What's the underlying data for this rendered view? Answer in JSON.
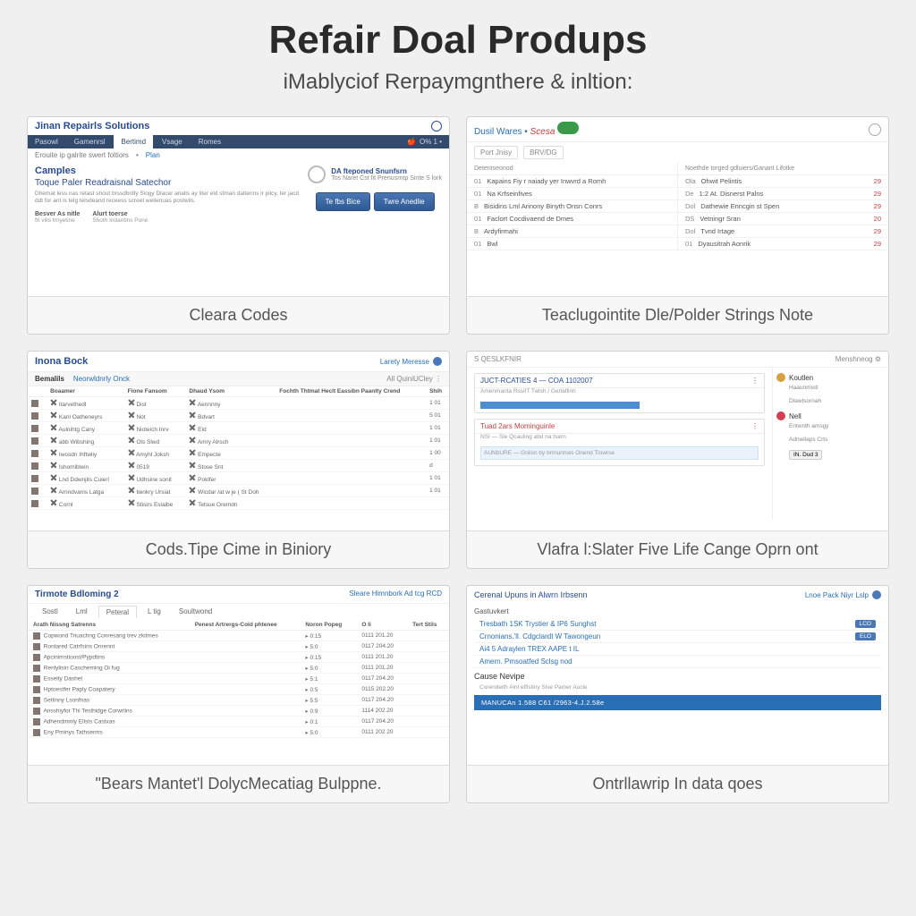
{
  "page": {
    "title": "Refair Doal Produps",
    "subtitle": "iMablyciof Rerpaymgnthere & inltion:"
  },
  "cards": [
    {
      "caption": "Cleara Codes",
      "brand": "Jinan Repairls Solutions",
      "nav": [
        "Pasowl",
        "Gamenrsl",
        "Bertimd",
        "Vsage",
        "Romes"
      ],
      "nav_right": "O% 1 •",
      "subline_a": "Erouite ip galrite swert foltiors",
      "subline_link": "Plan",
      "heading": "Camples",
      "subheading": "Toque Paler Readraisnal Satechor",
      "para": "Dhemat less nas retast shout brssdbritly Slogy Dlacer analis ay liter eld stman datienns ir pilcy, ter jacd ddt for ant is telg telsdeand receess screet welienuas postwils.",
      "col1_h": "Besver As nitle",
      "col1_p": "frl vilis trnyetine",
      "col2_h": "Alurt toerse",
      "col2_p": "Shoth Indantins Pune",
      "badge_a": "DA fteponed Snunfsrn",
      "badge_b": "Tos Naret Cst fit Prenusrntp Sinte S lork",
      "btn1": "Te fbs Bice",
      "btn2": "Twre Anedlie"
    },
    {
      "caption": "Teaclugointite Dle/Polder Strings Note",
      "brand_a": "Dusil Wares •",
      "brand_b": "Scesa",
      "tab1": "Port Jnisy",
      "tab2": "BRV/DG",
      "col1_header": "Detentseonod",
      "col2_header": "Noethde torged gdluiers/Ganant Lifotke",
      "left_rows": [
        {
          "b": "01",
          "l": "Kapains Fiy r naiady yer Inwvrd a Romh"
        },
        {
          "b": "01",
          "l": "Na Krfseinfives"
        },
        {
          "b": "B",
          "l": "Bisidins Lml Arinony Binyth Onsn Conrs"
        },
        {
          "b": "01",
          "l": "Faclort Cocdivaend de Dmes"
        },
        {
          "b": "B",
          "l": "Ardyfirmahi"
        },
        {
          "b": "01",
          "l": "Bwl"
        }
      ],
      "right_rows": [
        {
          "b": "Ola",
          "l": "Ohwit Pelintis",
          "n": "29"
        },
        {
          "b": "De",
          "l": "1:2 At. Disnerst Palns",
          "n": "29"
        },
        {
          "b": "Dol",
          "l": "Dathewie Enncgin st Spen",
          "n": "29"
        },
        {
          "b": "DS",
          "l": "Vetningr Sran",
          "n": "20"
        },
        {
          "b": "Dol",
          "l": "Tvnd Irtage",
          "n": "29"
        },
        {
          "b": "01",
          "l": "Dyausitrah Aonrik",
          "n": "29"
        }
      ]
    },
    {
      "caption": "Cods.Tipe Cime in Biniory",
      "brand": "Inona Bock",
      "link_text": "Larety Meresse",
      "bar_a": "Bemalils",
      "bar_b": "Neorwldnrly Onck",
      "bar_right": "All QuiniUCley  ⋮",
      "cols": [
        "",
        "Boaamer",
        "Fione Fansom",
        "Dhaud Ysom",
        "Fochth Thtmat Heclt Eassibn Paanlty Crend",
        "Shih"
      ],
      "rows": [
        [
          "",
          "Itarvethedl",
          "Dist",
          "Aennnny",
          "",
          "1  01"
        ],
        [
          "",
          "Kanl Oatheneyrs",
          "Not",
          "Bdvart",
          "",
          "5  01"
        ],
        [
          "",
          "Aulnihtg Cany",
          "Nioteich Inrv",
          "Eld",
          "",
          "1  01"
        ],
        [
          "",
          "abb Wibshing",
          "Ols Slwd",
          "Amry Alrsch",
          "",
          "1  01"
        ],
        [
          "",
          "Iwosdn Ihftwliy",
          "Amyhl Joksh",
          "Empecte",
          "",
          "1  00"
        ],
        [
          "",
          "Ishomibtein",
          "0519",
          "Stose Snt",
          "",
          "d"
        ],
        [
          "",
          "Lnd Ddwnjits Cuierl",
          "Udhsine sonit",
          "Poklfer",
          "",
          "1  01"
        ],
        [
          "",
          "Arnndvanis Latga",
          "tienkry Ursiat",
          "Wicdar /at w je ( St Doh",
          "",
          "1  01"
        ],
        [
          "",
          "Cornl",
          "Stisirs Eslaibe",
          "Tetsue Oremdn",
          "",
          ""
        ]
      ]
    },
    {
      "caption": "Vlafra l:Slater Five Life Cange Oprn ont",
      "top_left": "S QESLKFNIR",
      "top_right": "Menshneog ⚙",
      "panel1_h": "JUCT-RCATIES 4 — COA 1102007",
      "panel1_sub": "Amenmanta RssIlT Twlsh / Gerlaflinh",
      "panel2_h": "Tuad 2ars Mominguinle",
      "panel2_sub": "NSI — Sle Qcauling abd na tsern",
      "panel2_btn": "AUNbURE — Gniisn by brrnunnws  Onend Tiowrse",
      "side1_h": "Koutlen",
      "side1_items": [
        "Haaunmistl",
        "Dlawtsornah"
      ],
      "side2_h": "Nell",
      "side2_items": [
        "Entwnth amsgy",
        "Adnwilaps Crts",
        "IN. Dud  3"
      ]
    },
    {
      "caption": "\"Bears Mantet'l DolycMecatiag Bulppne.",
      "brand": "Tirmote Bdloming 2",
      "right_text": "Sleare Himnbork Ad tcg RCD",
      "tabs": [
        "Sostl",
        "Lml",
        "Peteral",
        "L tig",
        "Soultwond"
      ],
      "cols": [
        "Arath Nissng Satrenns",
        "Penest Artrergs-Cold phtenee",
        "Noron Popeg",
        "O li",
        "Tert Stils"
      ],
      "rows": [
        [
          "Copwond Triuachng Conresang trev zkitmes",
          "",
          "0:15",
          "0111 201.20",
          ""
        ],
        [
          "Rontared Catrfsins Onrennt",
          "",
          "5:0",
          "0117 204.20",
          ""
        ],
        [
          "Apcinimstioost/Pypdtins",
          "",
          "0:15",
          "0111 201.20",
          ""
        ],
        [
          "Renlylisin Cascheming Oi fug",
          "",
          "5:0",
          "0111 201.20",
          ""
        ],
        [
          "Esselty Dashet",
          "",
          "5:1",
          "0117 204.20",
          ""
        ],
        [
          "Hptoestfer Paply Coapatery",
          "",
          "0:5",
          "0115 202.20",
          ""
        ],
        [
          "Setlinny Lsonfnas",
          "",
          "5:5",
          "0117 204.20",
          ""
        ],
        [
          "Ansshiyfor Thi Testhidge Corwrlins",
          "",
          "0:9",
          "1114 202.20",
          ""
        ],
        [
          "Adhendminly Ellsts Castxas",
          "",
          "0:1",
          "0117 204.20",
          ""
        ],
        [
          "Eny Pminys Tathserms",
          "",
          "5:0",
          "0111 202 20",
          ""
        ]
      ]
    },
    {
      "caption": "Ontrllawrip In data qoes",
      "top": "Cerenal Upuns in Alwrn Irbsenn",
      "link": "Lnoe Pack Niyr Lslp",
      "sec1_h": "Gastuvkert",
      "items1": [
        {
          "t": "Tresbath 1SK Trystier & IP6 Sunghst",
          "badge": "LCO"
        },
        {
          "t": "Crnonians.'ll. Cdgclardt W Tawongeun",
          "badge": "ELO"
        },
        {
          "t": "Ai4 5 Adraylen TREX AAPE t IL",
          "badge": ""
        },
        {
          "t": "Amern. Pmsoatfed Sclsg nod",
          "badge": ""
        }
      ],
      "sec2_h": "Cause Nevipe",
      "sec2_sub": "Corendeith Ainl elfistiny Sive Pamer Aucle",
      "bluebar": "MANUCAn 1.588 C61 /2963-4.J.2.58e"
    }
  ]
}
